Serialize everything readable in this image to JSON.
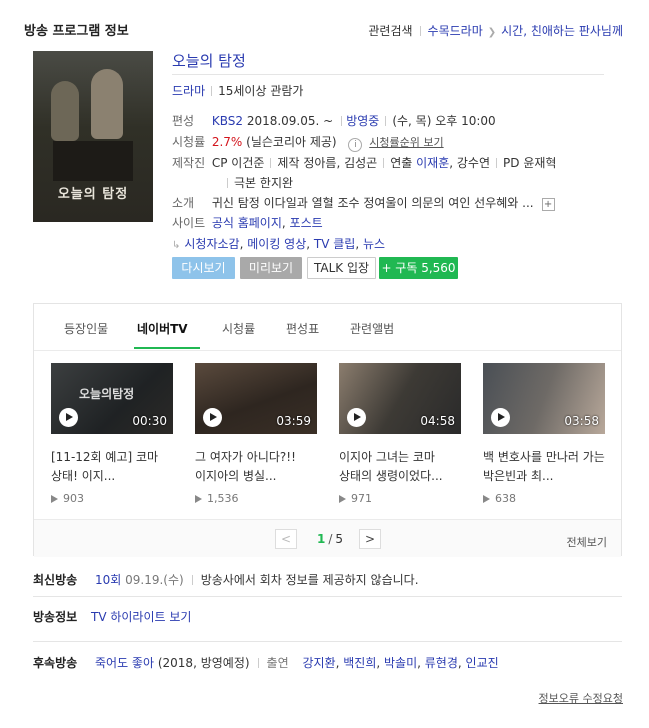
{
  "header": {
    "title": "방송 프로그램 정보",
    "related_label": "관련검색",
    "related_links": [
      "수목드라마",
      "시간, 친애하는 판사님께"
    ]
  },
  "program": {
    "poster_text": "오늘의 탐정",
    "title": "오늘의 탐정",
    "genre": "드라마",
    "rating_age": "15세이상 관람가",
    "schedule_label": "편성",
    "channel": "KBS2",
    "start_date": "2018.09.05. ~",
    "status": "방영중",
    "airtime": "(수, 목) 오후 10:00",
    "viewership_label": "시청률",
    "viewership_value": "2.7%",
    "viewership_source": "(닐슨코리아 제공)",
    "viewership_info_icon": "i",
    "viewership_link": "시청률순위 보기",
    "production_label": "제작진",
    "crew": [
      {
        "role": "CP",
        "name": "이건준"
      },
      {
        "role": "제작",
        "name": "정아름, 김성곤"
      },
      {
        "role": "연출",
        "name": "이재훈",
        "name2": "강수연"
      },
      {
        "role": "PD",
        "name": "윤재혁"
      },
      {
        "role": "극본",
        "name": "한지완"
      }
    ],
    "synopsis_label": "소개",
    "synopsis": "귀신 탐정 이다일과 열혈 조수 정여울이 의문의 여인 선우혜와 ...",
    "site_label": "사이트",
    "site_links": [
      "공식 홈페이지",
      "포스트"
    ],
    "sub_links": [
      "시청자소감",
      "메이킹 영상",
      "TV 클립",
      "뉴스"
    ]
  },
  "actions": {
    "replay": "다시보기",
    "preview": "미리보기",
    "talk": "TALK 입장",
    "subscribe": "+ 구독 5,560"
  },
  "tabs": [
    "등장인물",
    "네이버TV",
    "시청률",
    "편성표",
    "관련앨범"
  ],
  "active_tab": "네이버TV",
  "videos": [
    {
      "title": "[11-12회 예고] 코마 상태! 이지...",
      "duration": "00:30",
      "views": "903",
      "overlay": "오늘의탐정"
    },
    {
      "title": "그 여자가 아니다?!! 이지아의 병실...",
      "duration": "03:59",
      "views": "1,536",
      "overlay": ""
    },
    {
      "title": "이지아 그녀는 코마 상태의 생령이었다...",
      "duration": "04:58",
      "views": "971",
      "overlay": ""
    },
    {
      "title": "백 변호사를 만나러 가는 박은빈과 최...",
      "duration": "03:58",
      "views": "638",
      "overlay": ""
    }
  ],
  "pager": {
    "current": "1",
    "total": "5",
    "prev": "<",
    "next": ">",
    "all_label": "전체보기"
  },
  "latest": {
    "label": "최신방송",
    "episode": "10회",
    "date": "09.19.(수)",
    "note": "방송사에서 회차 정보를 제공하지 않습니다."
  },
  "broadcast_info": {
    "label": "방송정보",
    "link": "TV 하이라이트 보기"
  },
  "following": {
    "label": "후속방송",
    "title": "죽어도 좋아",
    "meta": "(2018, 방영예정)",
    "cast_label": "출연",
    "cast": [
      "강지환",
      "백진희",
      "박솔미",
      "류현경",
      "인교진"
    ]
  },
  "footer": {
    "report_link": "정보오류 수정요청"
  },
  "colors": {
    "link": "#2a3bb0",
    "green": "#20b852",
    "red": "#d3141c"
  }
}
